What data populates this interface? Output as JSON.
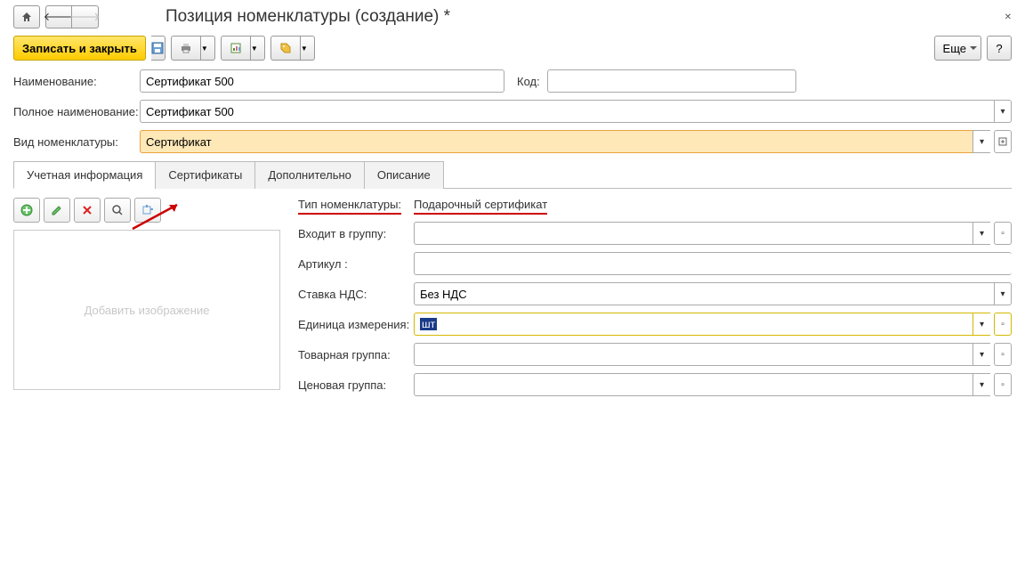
{
  "header": {
    "title": "Позиция номенклатуры (создание) *"
  },
  "toolbar": {
    "save_close": "Записать и закрыть",
    "more": "Еще",
    "help": "?"
  },
  "fields": {
    "name_label": "Наименование:",
    "name_value": "Сертификат 500",
    "code_label": "Код:",
    "code_value": "",
    "full_name_label": "Полное наименование:",
    "full_name_value": "Сертификат 500",
    "kind_label": "Вид номенклатуры:",
    "kind_value": "Сертификат"
  },
  "tabs": [
    "Учетная информация",
    "Сертификаты",
    "Дополнительно",
    "Описание"
  ],
  "image_placeholder": "Добавить изображение",
  "details": {
    "type_label": "Тип номенклатуры:",
    "type_value": "Подарочный сертификат",
    "group_label": "Входит в группу:",
    "group_value": "",
    "article_label": "Артикул :",
    "article_value": "",
    "vat_label": "Ставка НДС:",
    "vat_value": "Без НДС",
    "unit_label": "Единица измерения:",
    "unit_value": "шт",
    "prod_group_label": "Товарная группа:",
    "prod_group_value": "",
    "price_group_label": "Ценовая группа:",
    "price_group_value": ""
  }
}
